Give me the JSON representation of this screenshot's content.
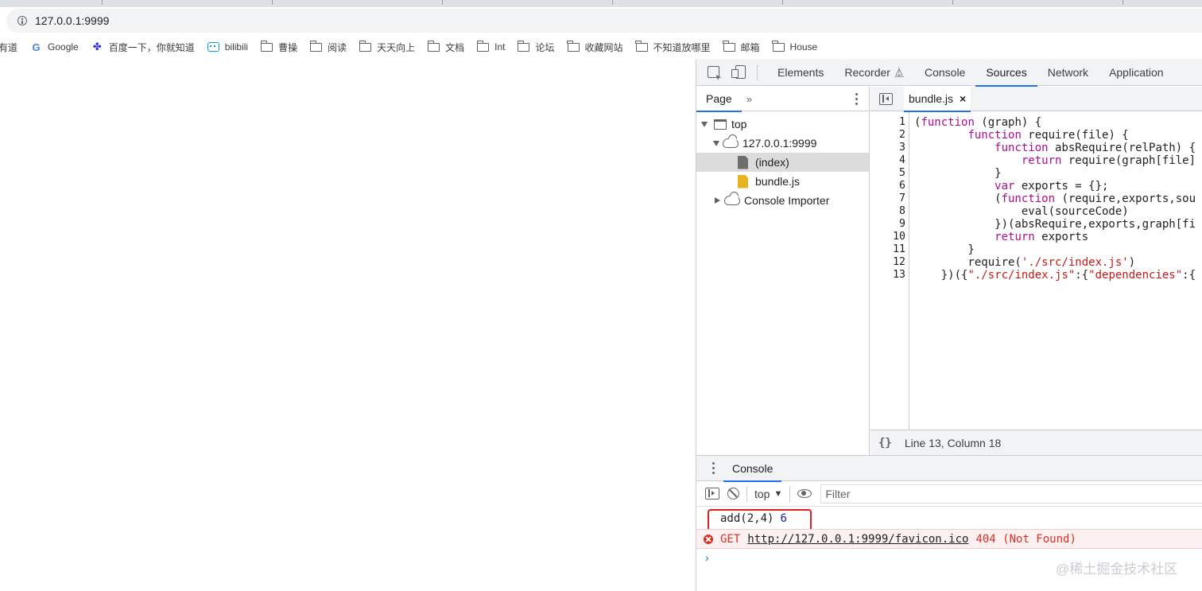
{
  "address_bar": {
    "url": "127.0.0.1:9999"
  },
  "bookmarks": [
    {
      "label": "有道",
      "icon": "bookmark-partial"
    },
    {
      "label": "Google",
      "icon": "google-icon"
    },
    {
      "label": "百度一下，你就知道",
      "icon": "baidu-icon"
    },
    {
      "label": "bilibili",
      "icon": "bilibili-icon"
    },
    {
      "label": "曹操",
      "icon": "folder-icon"
    },
    {
      "label": "阅读",
      "icon": "folder-icon"
    },
    {
      "label": "天天向上",
      "icon": "folder-icon"
    },
    {
      "label": "文档",
      "icon": "folder-icon"
    },
    {
      "label": "Int",
      "icon": "folder-icon"
    },
    {
      "label": "论坛",
      "icon": "folder-icon"
    },
    {
      "label": "收藏网站",
      "icon": "folder-icon"
    },
    {
      "label": "不知道放哪里",
      "icon": "folder-icon"
    },
    {
      "label": "邮箱",
      "icon": "folder-icon"
    },
    {
      "label": "House",
      "icon": "folder-icon"
    }
  ],
  "devtools": {
    "tabs": [
      "Elements",
      "Recorder",
      "Console",
      "Sources",
      "Network",
      "Application"
    ],
    "active_tab": "Sources",
    "navigator": {
      "tab": "Page",
      "more": "»",
      "tree": {
        "top": "top",
        "origin": "127.0.0.1:9999",
        "index": "(index)",
        "bundle": "bundle.js",
        "importer": "Console Importer"
      }
    },
    "editor": {
      "file_tab": "bundle.js",
      "close": "×",
      "line_numbers": [
        "1",
        "2",
        "3",
        "4",
        "5",
        "6",
        "7",
        "8",
        "9",
        "10",
        "11",
        "12",
        "13"
      ],
      "status": "Line 13, Column 18",
      "pretty_print": "{}"
    },
    "drawer": {
      "tab": "Console",
      "context": "top",
      "filter_placeholder": "Filter",
      "log_text": "add(2,4)",
      "log_value": "6",
      "error_method": "GET",
      "error_url": "http://127.0.0.1:9999/favicon.ico",
      "error_status": "404 (Not Found)",
      "prompt": "›"
    }
  },
  "watermark": "@稀土掘金技术社区",
  "colors": {
    "keyword": "#aa0d91",
    "string": "#c41a16",
    "accent": "#1a73e8",
    "error": "#d93025",
    "highlight_box": "#e02020"
  }
}
